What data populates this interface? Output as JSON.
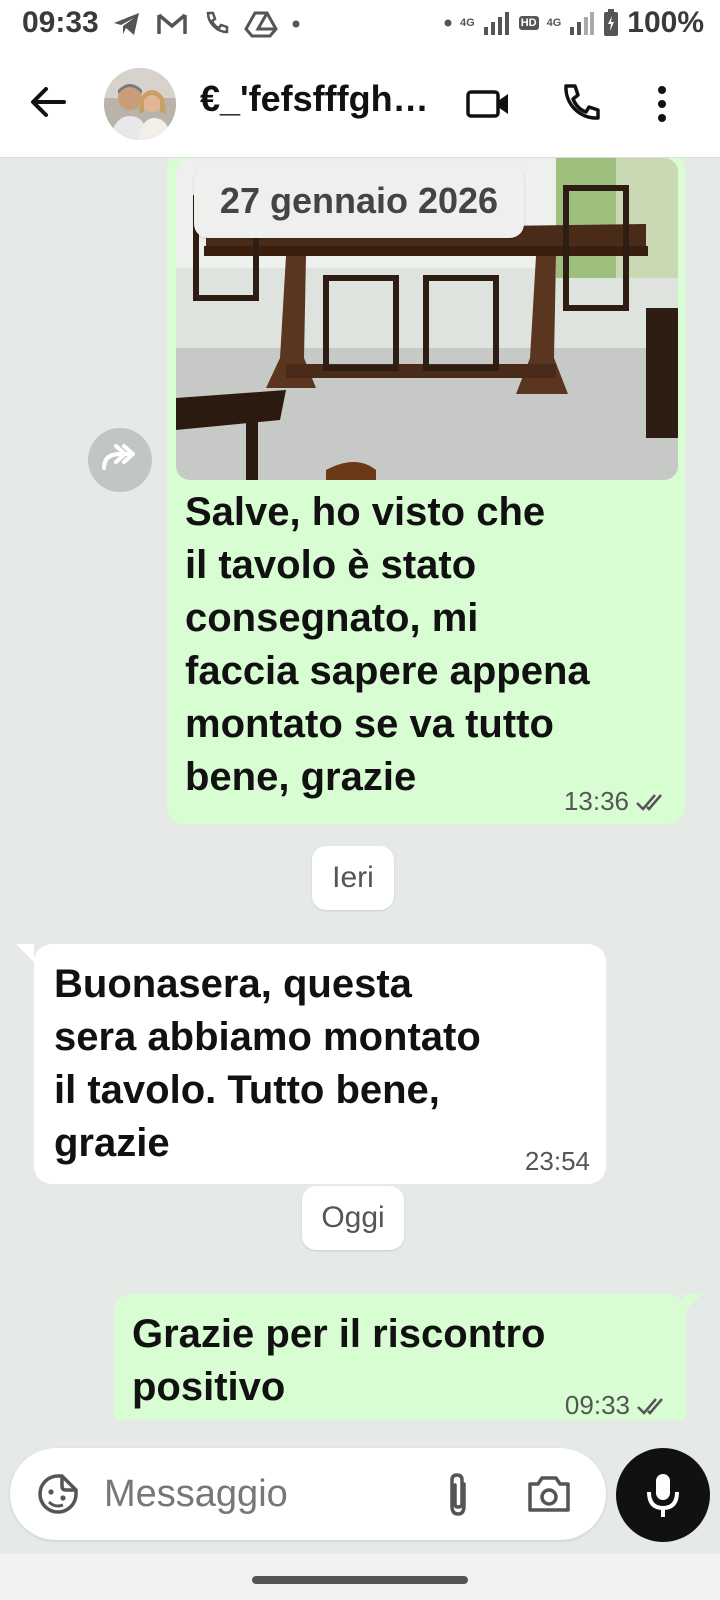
{
  "status_bar": {
    "time": "09:33",
    "battery_pct": "100%",
    "net_label_1": "4G",
    "net_label_2": "HD",
    "net_label_3": "4G"
  },
  "header": {
    "contact_name": "€_'fefsfffgh…",
    "icons": [
      "back-arrow-icon",
      "video-call-icon",
      "phone-icon",
      "more-vert-icon"
    ]
  },
  "chat": {
    "messages": [
      {
        "direction": "outgoing",
        "date_label": "27 gennaio 2026",
        "text": "Salve, ho visto che\nil tavolo è stato\nconsegnato, mi\nfaccia sapere appena\nmontato se va tutto\nbene, grazie",
        "time": "13:36",
        "read": true
      },
      {
        "day_separator": "Ieri",
        "direction": "incoming",
        "text": "Buonasera, questa\nsera abbiamo montato\nil tavolo.  Tutto bene,\ngrazie",
        "time": "23:54"
      },
      {
        "day_separator": "Oggi",
        "direction": "outgoing",
        "text": "Grazie per il riscontro\npositivo",
        "time": "09:33",
        "read": true
      }
    ]
  },
  "composer": {
    "placeholder": "Messaggio",
    "value": ""
  },
  "colors": {
    "outgoing_bubble": "#d9fdd3",
    "incoming_bubble": "#ffffff",
    "chat_background": "#e6eae7",
    "read_ticks": "#555555"
  }
}
